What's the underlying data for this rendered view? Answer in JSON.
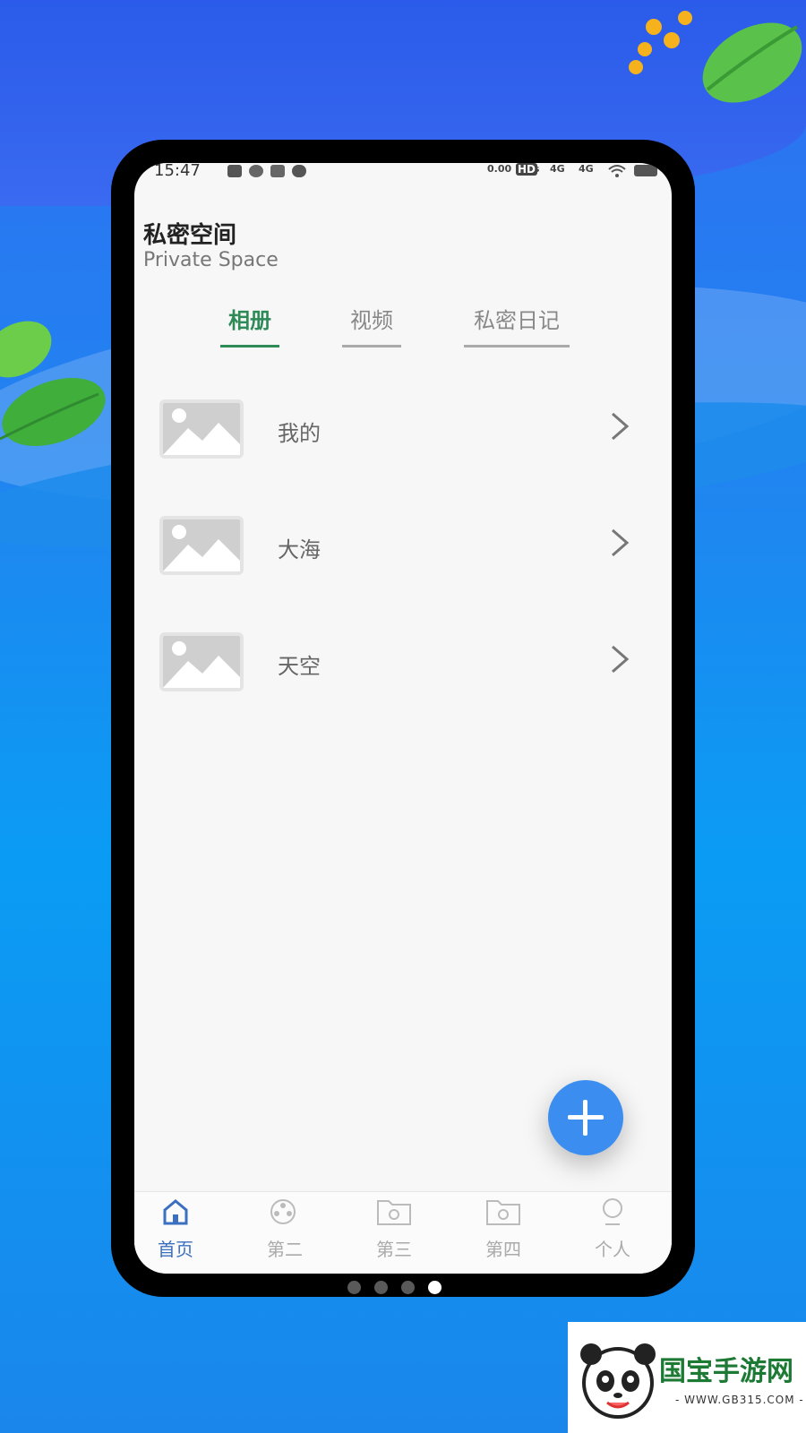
{
  "status_bar": {
    "time": "15:47",
    "net_speed": "0.00 KB/s",
    "hd": "HD",
    "signal1": "4G",
    "signal2": "4G"
  },
  "header": {
    "title": "私密空间",
    "subtitle": "Private Space"
  },
  "tabs": [
    {
      "label": "相册",
      "active": true
    },
    {
      "label": "视频",
      "active": false
    },
    {
      "label": "私密日记",
      "active": false
    }
  ],
  "albums": [
    {
      "name": "我的"
    },
    {
      "name": "大海"
    },
    {
      "name": "天空"
    }
  ],
  "bottom_nav": [
    {
      "label": "首页",
      "icon": "home-icon",
      "active": true
    },
    {
      "label": "第二",
      "icon": "film-reel-icon",
      "active": false
    },
    {
      "label": "第三",
      "icon": "folder-icon",
      "active": false
    },
    {
      "label": "第四",
      "icon": "folder-icon",
      "active": false
    },
    {
      "label": "个人",
      "icon": "person-icon",
      "active": false
    }
  ],
  "pager": {
    "count": 4,
    "active_index": 3
  },
  "watermark": {
    "name": "国宝手游网",
    "url": "- WWW.GB315.COM -"
  },
  "colors": {
    "accent": "#2e8b57",
    "fab": "#3b8ef0",
    "background": "#1f86f0"
  }
}
